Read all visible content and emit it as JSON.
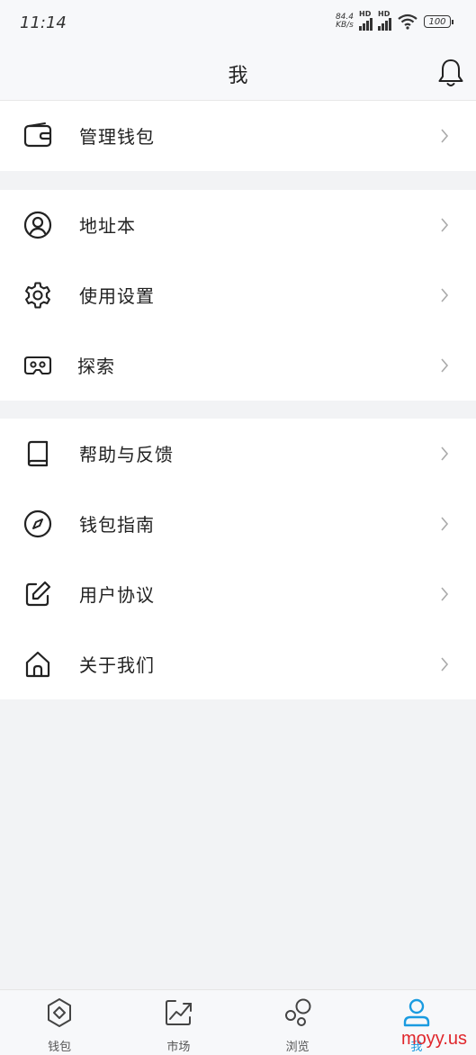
{
  "status_bar": {
    "time": "11:14",
    "net_speed_value": "84.4",
    "net_speed_unit": "KB/s",
    "hd1": "HD",
    "hd2": "HD",
    "battery": "100"
  },
  "header": {
    "title": "我",
    "bell_icon": "bell-icon"
  },
  "groups": [
    {
      "items": [
        {
          "label": "管理钱包",
          "icon": "wallet-icon"
        }
      ]
    },
    {
      "items": [
        {
          "label": "地址本",
          "icon": "user-circle-icon"
        },
        {
          "label": "使用设置",
          "icon": "gear-icon"
        },
        {
          "label": "探索",
          "icon": "vr-goggles-icon"
        }
      ]
    },
    {
      "items": [
        {
          "label": "帮助与反馈",
          "icon": "book-icon"
        },
        {
          "label": "钱包指南",
          "icon": "compass-icon"
        },
        {
          "label": "用户协议",
          "icon": "edit-icon"
        },
        {
          "label": "关于我们",
          "icon": "home-icon"
        }
      ]
    }
  ],
  "tabbar": {
    "tabs": [
      {
        "label": "钱包",
        "icon": "wallet-tab-icon"
      },
      {
        "label": "市场",
        "icon": "chart-trend-icon"
      },
      {
        "label": "浏览",
        "icon": "bubbles-icon"
      },
      {
        "label": "我",
        "icon": "user-icon",
        "active": true
      }
    ],
    "active_color": "#1a9be0"
  },
  "watermark": "moyy.us"
}
